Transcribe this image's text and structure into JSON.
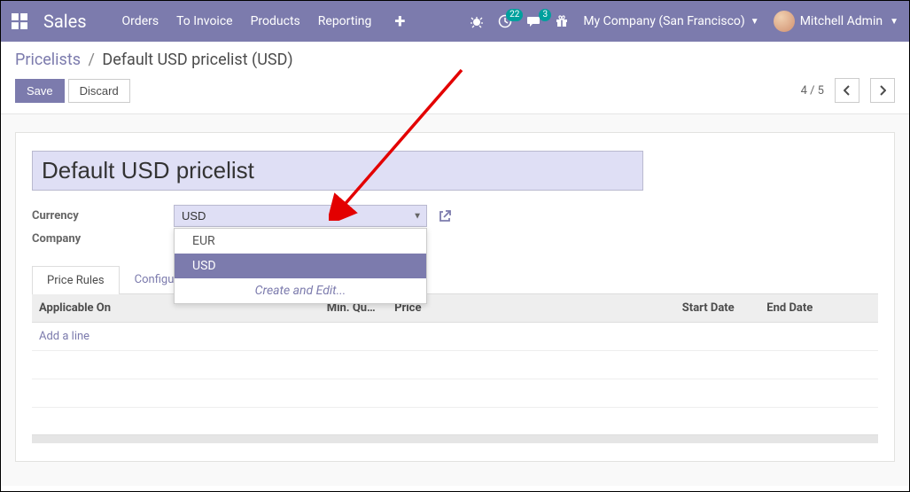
{
  "topnav": {
    "brand": "Sales",
    "links": [
      "Orders",
      "To Invoice",
      "Products",
      "Reporting"
    ],
    "activities_badge": "22",
    "discuss_badge": "3",
    "company": "My Company (San Francisco)",
    "user": "Mitchell Admin"
  },
  "breadcrumb": {
    "parent": "Pricelists",
    "current": "Default USD pricelist (USD)"
  },
  "buttons": {
    "save": "Save",
    "discard": "Discard"
  },
  "pager": {
    "text": "4 / 5"
  },
  "form": {
    "title_value": "Default USD pricelist",
    "currency_label": "Currency",
    "currency_value": "USD",
    "company_label": "Company"
  },
  "dropdown": {
    "opt1": "EUR",
    "opt2": "USD",
    "create_edit": "Create and Edit..."
  },
  "tabs": {
    "price_rules": "Price Rules",
    "configuration": "Configuration"
  },
  "table": {
    "col_applicable": "Applicable On",
    "col_minqty": "Min. Qu…",
    "col_price": "Price",
    "col_start": "Start Date",
    "col_end": "End Date",
    "add_line": "Add a line"
  }
}
